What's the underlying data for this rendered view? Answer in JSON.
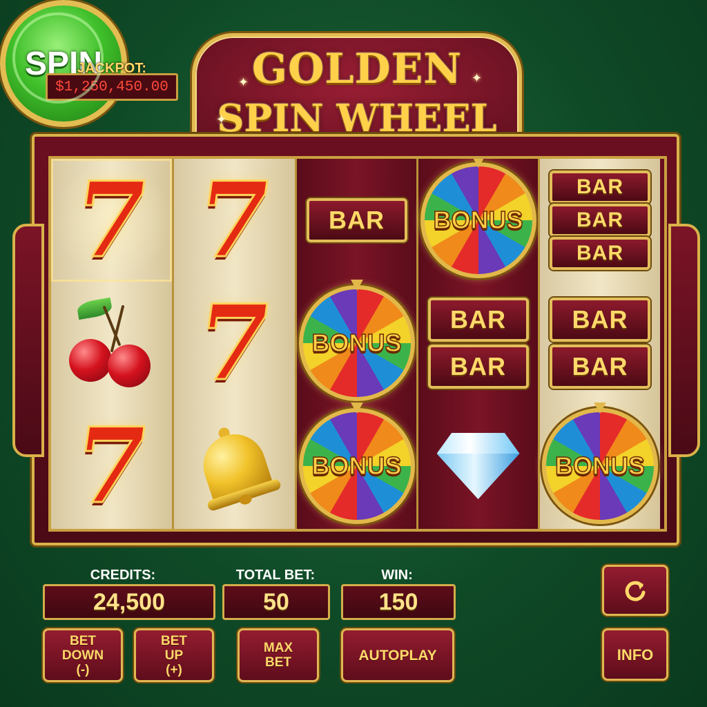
{
  "jackpot": {
    "label": "JACKPOT:",
    "amount": "$1,250,450.00"
  },
  "title": {
    "line1": "GOLDEN",
    "line2": "SPIN WHEEL"
  },
  "reels": [
    [
      "seven",
      "cherry",
      "seven"
    ],
    [
      "seven",
      "seven",
      "bell"
    ],
    [
      "bar",
      "bonus",
      "bonus"
    ],
    [
      "bonus",
      "double-bar",
      "diamond"
    ],
    [
      "triple-bar",
      "double-bar",
      "bonus"
    ]
  ],
  "symbols": {
    "bar": "BAR",
    "bonus": "BONUS",
    "seven": "7"
  },
  "stats": {
    "credits_label": "CREDITS:",
    "credits_value": "24,500",
    "bet_label": "TOTAL BET:",
    "bet_value": "50",
    "win_label": "WIN:",
    "win_value": "150"
  },
  "buttons": {
    "bet_down": [
      "BET",
      "DOWN",
      "(-)"
    ],
    "bet_up": [
      "BET",
      "UP",
      "(+)"
    ],
    "max_bet": [
      "MAX",
      "BET"
    ],
    "autoplay": "AUTOPLAY",
    "spin": "SPIN",
    "info": "INFO"
  },
  "icons": {
    "refresh": "refresh-icon"
  },
  "colors": {
    "background": "#0f4a27",
    "maroon": "#6b0f20",
    "gold": "#d9b24a",
    "spin_green": "#3fbf2a"
  }
}
